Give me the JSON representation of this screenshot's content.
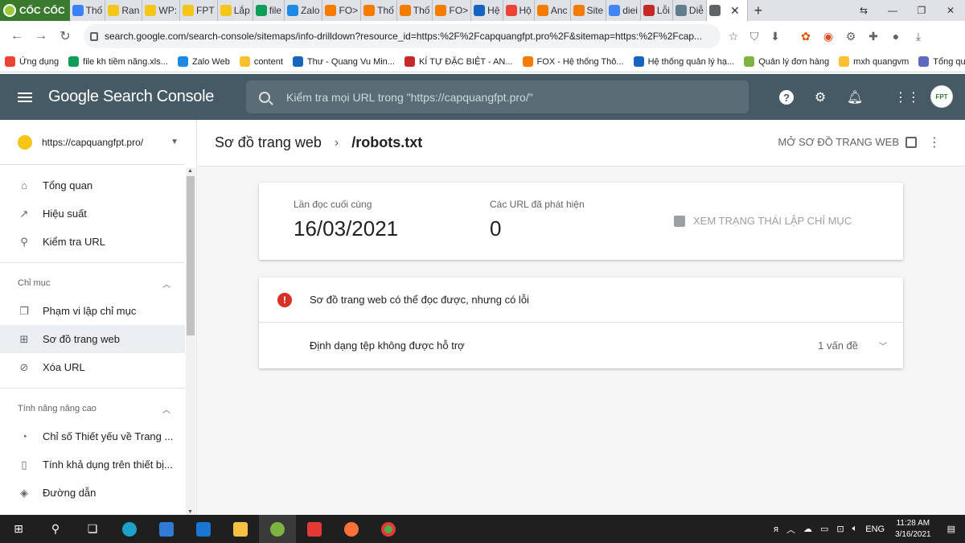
{
  "browser": {
    "brand": "CỐC CỐC",
    "tabs": [
      {
        "label": "Thố",
        "color": "#3b82f6",
        "fav": "wb"
      },
      {
        "label": "Ran",
        "color": "#f5c518"
      },
      {
        "label": "WP:",
        "color": "#f5c518"
      },
      {
        "label": "FPT",
        "color": "#f5c518"
      },
      {
        "label": "Lắp",
        "color": "#f5c518"
      },
      {
        "label": "file",
        "color": "#0f9d58"
      },
      {
        "label": "Zalo",
        "color": "#1e88e5"
      },
      {
        "label": "FO>",
        "color": "#f57c00"
      },
      {
        "label": "Thố",
        "color": "#f57c00"
      },
      {
        "label": "Thố",
        "color": "#f57c00"
      },
      {
        "label": "FO>",
        "color": "#f57c00"
      },
      {
        "label": "Hệ",
        "color": "#1565c0"
      },
      {
        "label": "Hộ",
        "color": "#ea4335"
      },
      {
        "label": "Anc",
        "color": "#f57c00"
      },
      {
        "label": "Site",
        "color": "#f57c00"
      },
      {
        "label": "diei",
        "color": "#4285f4"
      },
      {
        "label": "Lỗi",
        "color": "#c62828"
      },
      {
        "label": "Diễ",
        "color": "#607d8b"
      },
      {
        "label": "",
        "color": "#5f6368",
        "active": true
      }
    ],
    "url": "search.google.com/search-console/sitemaps/info-drilldown?resource_id=https:%2F%2Fcapquangfpt.pro%2F&sitemap=https:%2F%2Fcap..."
  },
  "bookmarks": [
    {
      "label": "Ứng dụng",
      "color": "#ea4335"
    },
    {
      "label": "file kh tiềm năng.xls...",
      "color": "#0f9d58"
    },
    {
      "label": "Zalo Web",
      "color": "#1e88e5"
    },
    {
      "label": "content",
      "color": "#fbc02d"
    },
    {
      "label": "Thư - Quang Vu Min...",
      "color": "#1565c0"
    },
    {
      "label": "KÍ TỰ ĐẶC BIỆT - AN...",
      "color": "#c62828"
    },
    {
      "label": "FOX - Hệ thống Thô...",
      "color": "#f57c00"
    },
    {
      "label": "Hệ thống quản lý hạ...",
      "color": "#1565c0"
    },
    {
      "label": "Quản lý đơn hàng",
      "color": "#7cb342"
    },
    {
      "label": "mxh quangvm",
      "color": "#fbc02d"
    },
    {
      "label": "Tổng quan",
      "color": "#5c6bc0"
    }
  ],
  "gsc": {
    "title": "Google Search Console",
    "search_placeholder": "Kiểm tra mọi URL trong \"https://capquangfpt.pro/\"",
    "avatar_text": "FPT"
  },
  "sidebar": {
    "property": "https://capquangfpt.pro/",
    "top_items": [
      {
        "label": "Tổng quan",
        "icon": "home-icon",
        "glyph": "⌂"
      },
      {
        "label": "Hiệu suất",
        "icon": "trend-icon",
        "glyph": "↗"
      },
      {
        "label": "Kiểm tra URL",
        "icon": "search-icon",
        "glyph": "⚲"
      }
    ],
    "index_section": "Chỉ mục",
    "index_items": [
      {
        "label": "Phạm vi lập chỉ mục",
        "icon": "coverage-icon",
        "glyph": "❐"
      },
      {
        "label": "Sơ đồ trang web",
        "icon": "sitemap-icon",
        "glyph": "⊞",
        "selected": true
      },
      {
        "label": "Xóa URL",
        "icon": "removals-icon",
        "glyph": "⊘"
      }
    ],
    "enh_section": "Tính năng nâng cao",
    "enh_items": [
      {
        "label": "Chỉ số Thiết yếu về Trang ...",
        "icon": "gauge-icon",
        "glyph": "◔"
      },
      {
        "label": "Tính khả dụng trên thiết bị...",
        "icon": "mobile-icon",
        "glyph": "▯"
      },
      {
        "label": "Đường dẫn",
        "icon": "layers-icon",
        "glyph": "◈"
      }
    ]
  },
  "main": {
    "breadcrumb_parent": "Sơ đồ trang web",
    "breadcrumb_sep": "›",
    "breadcrumb_current": "/robots.txt",
    "open_sitemap": "MỞ SƠ ĐỒ TRANG WEB",
    "last_read_label": "Lần đọc cuối cùng",
    "last_read_value": "16/03/2021",
    "discovered_label": "Các URL đã phát hiện",
    "discovered_value": "0",
    "coverage_link": "XEM TRẠNG THÁI LẬP CHỈ MỤC",
    "error_message": "Sơ đồ trang web có thể đọc được, nhưng có lỗi",
    "issue_label": "Định dạng tệp không được hỗ trợ",
    "issue_count": "1 vấn đề"
  },
  "taskbar": {
    "lang": "ENG",
    "time": "11:28 AM",
    "date": "3/16/2021"
  }
}
